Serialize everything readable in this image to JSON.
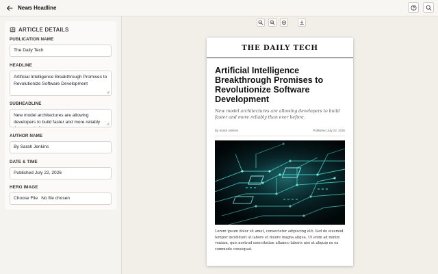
{
  "app": {
    "title": "News Headline"
  },
  "icons": {
    "back": "arrow-left-icon",
    "help": "help-circle-icon",
    "search": "search-icon",
    "zoom_out": "zoom-out-icon",
    "zoom_in": "zoom-in-icon",
    "fit": "fit-screen-icon",
    "download": "download-icon",
    "panel": "article-details-icon"
  },
  "sidebar": {
    "title": "ARTICLE DETAILS",
    "publication": {
      "label": "PUBLICATION NAME",
      "value": "The Daily Tech"
    },
    "headline": {
      "label": "HEADLINE",
      "value": "Artificial Intelligence Breakthrough Promises to Revolutionize Software Development"
    },
    "subheadline": {
      "label": "SUBHEADLINE",
      "value": "New model architectures are allowing developers to build faster and more reliably than ever before."
    },
    "author": {
      "label": "AUTHOR NAME",
      "value": "By Sarah Jenkins"
    },
    "date": {
      "label": "DATE & TIME",
      "value": "Published July 22, 2026"
    },
    "hero": {
      "label": "HERO IMAGE",
      "button": "Choose File",
      "status": "No file chosen"
    }
  },
  "article": {
    "masthead": "THE DAILY TECH",
    "headline": "Artificial Intelligence Breakthrough Promises to Revolutionize Software Development",
    "subheadline": "New model architectures are allowing developers to build faster and more reliably than ever before.",
    "byline": "By Sarah Jenkins",
    "date": "Published July 22, 2026",
    "body": "Lorem ipsum dolor sit amet, consectetur adipiscing elit. Sed do eiusmod tempor incididunt ut labore et dolore magna aliqua. Ut enim ad minim veniam, quis nostrud exercitation ullamco laboris nisi ut aliquip ex ea commodo consequat."
  },
  "colors": {
    "accent_circuit": "#39d7d0",
    "page_bg": "#f1efe8"
  }
}
